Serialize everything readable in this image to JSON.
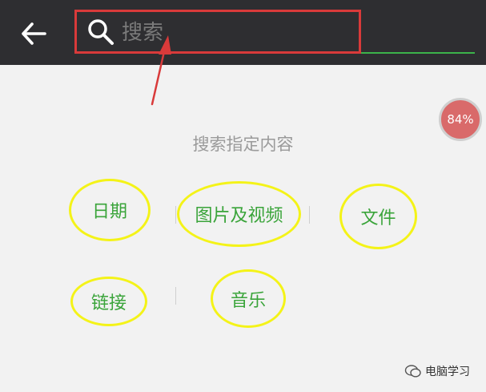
{
  "search": {
    "placeholder": "搜索"
  },
  "badge": {
    "text": "84%"
  },
  "heading": "搜索指定内容",
  "categories": {
    "date": "日期",
    "media": "图片及视频",
    "file": "文件",
    "link": "链接",
    "music": "音乐"
  },
  "watermark": {
    "text": "电脑学习"
  },
  "colors": {
    "topbar": "#2e2e31",
    "accent_green": "#3aa43a",
    "annotation_red": "#d93a3a",
    "annotation_yellow": "#f4f318"
  },
  "icons": {
    "back": "back-arrow-icon",
    "search": "search-icon"
  }
}
